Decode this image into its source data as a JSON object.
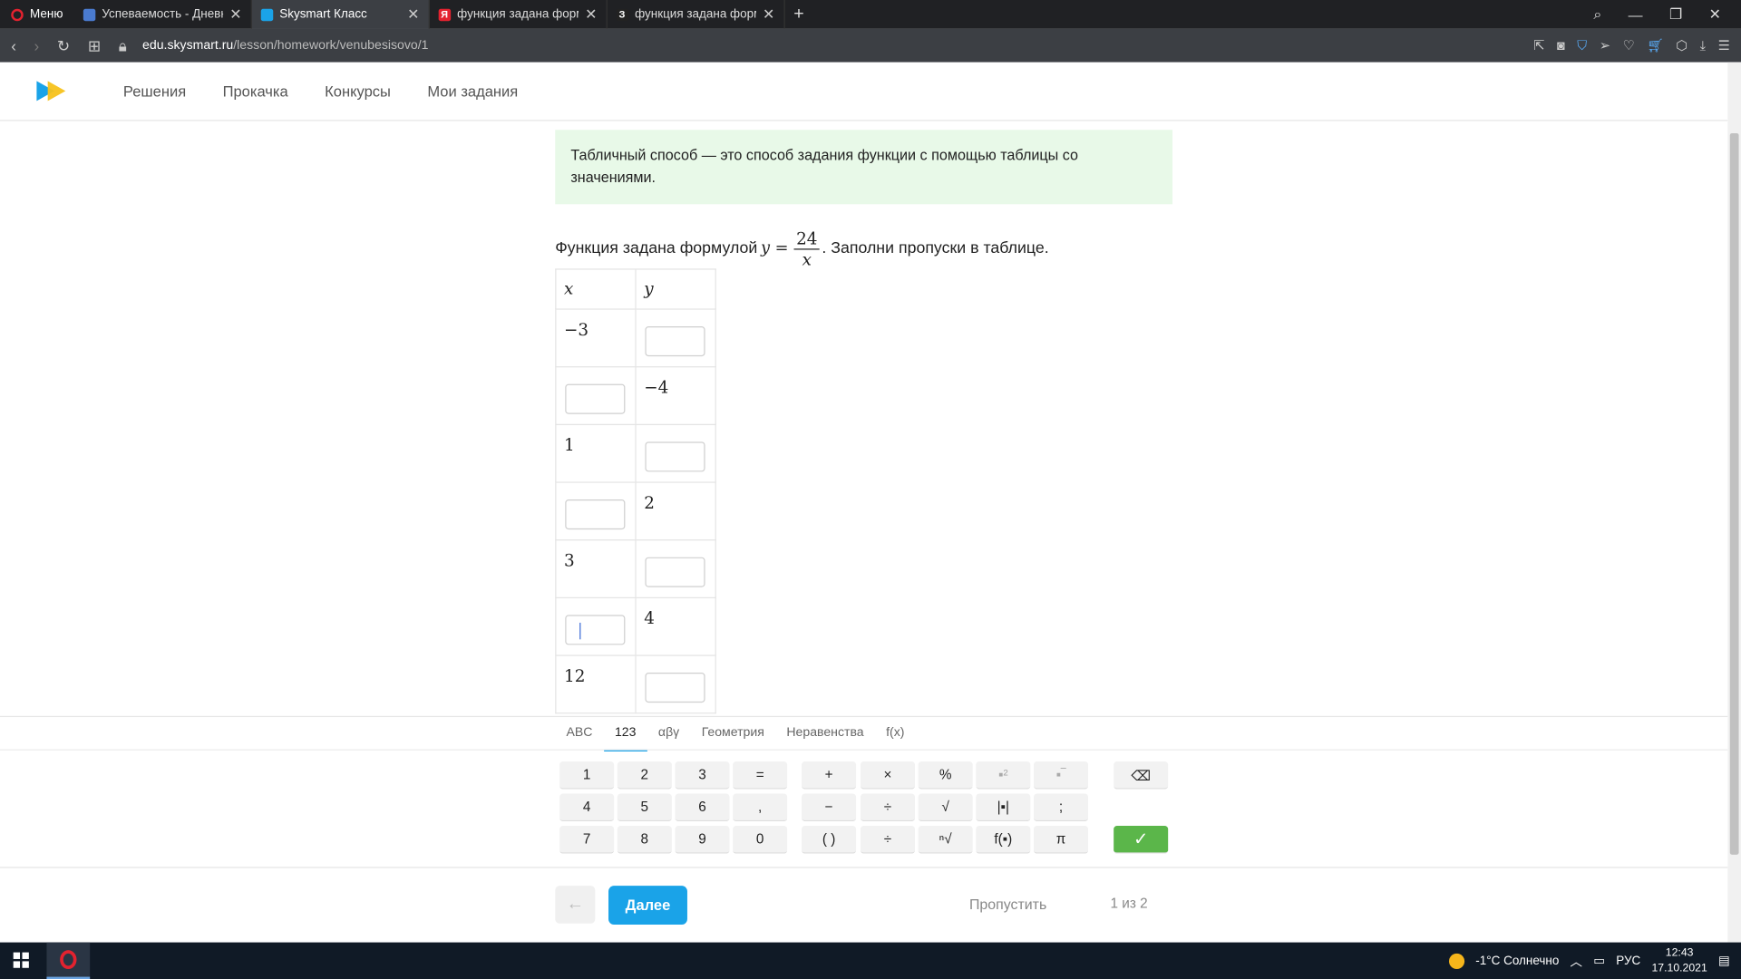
{
  "browser": {
    "menu_label": "Меню",
    "tabs": [
      {
        "title": "Успеваемость - Дневник.р",
        "active": false
      },
      {
        "title": "Skysmart Класс",
        "active": true
      },
      {
        "title": "функция задана формулой у",
        "active": false
      },
      {
        "title": "функция задана формуло",
        "active": false
      }
    ],
    "url_domain": "edu.skysmart.ru",
    "url_path": "/lesson/homework/venubesisovo/1"
  },
  "site": {
    "nav": [
      "Решения",
      "Прокачка",
      "Конкурсы",
      "Мои задания"
    ]
  },
  "content": {
    "note": "Табличный способ — это способ задания функции с помощью таблицы со значениями.",
    "task_prefix": "Функция задана формулой",
    "formula_lhs": "y =",
    "formula_num": "24",
    "formula_den": "x",
    "task_suffix": ". Заполни пропуски в таблице.",
    "table_headers": [
      "x",
      "y"
    ],
    "table_rows": [
      {
        "x": "−3",
        "y": ""
      },
      {
        "x": "",
        "y": "−4"
      },
      {
        "x": "1",
        "y": ""
      },
      {
        "x": "",
        "y": "2"
      },
      {
        "x": "3",
        "y": ""
      },
      {
        "x": "",
        "y": "4"
      },
      {
        "x": "12",
        "y": ""
      }
    ]
  },
  "keyboard": {
    "tabs": [
      "ABC",
      "123",
      "αβγ",
      "Геометрия",
      "Неравенства",
      "f(x)"
    ],
    "active_tab": "123",
    "keys": {
      "k1": "1",
      "k2": "2",
      "k3": "3",
      "eq": "=",
      "plus": "+",
      "times": "×",
      "pct": "%",
      "k4": "4",
      "k5": "5",
      "k6": "6",
      "comma": ",",
      "minus": "−",
      "div": "÷",
      "sqrt": "√",
      "abs": "|▪|",
      "semi": ";",
      "k7": "7",
      "k8": "8",
      "k9": "9",
      "k0": "0",
      "paren": "( )",
      "frac": "÷",
      "nroot": "ⁿ√",
      "func": "f(▪)",
      "pi": "π"
    }
  },
  "footer": {
    "next_label": "Далее",
    "skip_label": "Пропустить",
    "progress": "1 из 2"
  },
  "taskbar": {
    "weather": "-1°C Солнечно",
    "lang": "РУС",
    "time": "12:43",
    "date": "17.10.2021"
  },
  "colors": {
    "accent": "#1aa3e8",
    "note_bg": "#e8f9e8",
    "ok": "#5bb64a"
  }
}
